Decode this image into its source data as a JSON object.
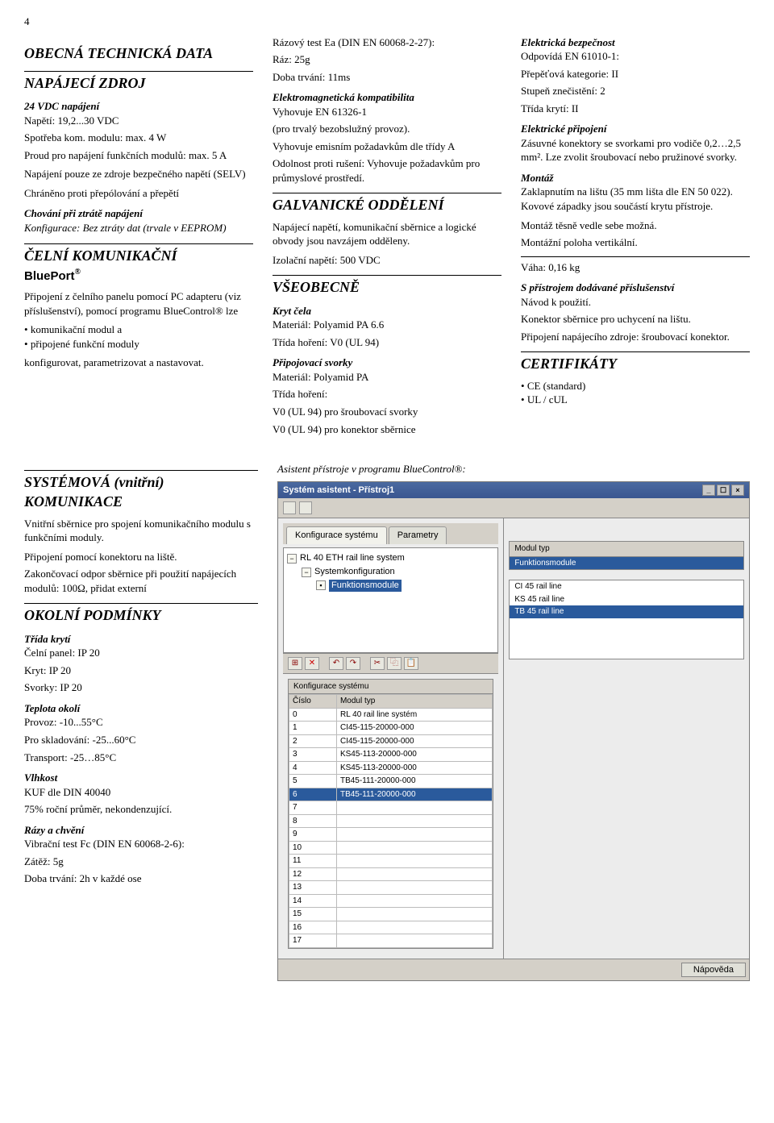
{
  "page_number": "4",
  "col1": {
    "h1": "OBECNÁ TECHNICKÁ DATA",
    "h2": "NAPÁJECÍ ZDROJ",
    "p1": "24 VDC napájení",
    "p2": "Napětí: 19,2...30 VDC",
    "p3": "Spotřeba kom. modulu: max. 4 W",
    "p4": "Proud pro napájení funkčních modulů: max. 5 A",
    "p5": "Napájení pouze ze zdroje bezpečného napětí (SELV)",
    "p6": "Chráněno proti přepólování a přepětí",
    "p7t": "Chování při ztrátě napájení",
    "p7": "Konfigurace: Bez ztráty dat (trvale v EEPROM)",
    "h3": "ČELNÍ KOMUNIKAČNÍ",
    "h3b": "BluePort",
    "h3s": "®",
    "p8": "Připojení z čelního panelu pomocí PC adapteru (viz příslušenství), pomocí programu BlueControl® lze",
    "b1": "komunikační modul a",
    "b2": "připojené funkční moduly",
    "p9": "konfigurovat, parametrizovat a nastavovat."
  },
  "col2": {
    "p1": "Rázový test Ea (DIN EN 60068-2-27):",
    "p2": "Ráz: 25g",
    "p3": "Doba trvání: 11ms",
    "p4t": "Elektromagnetická kompatibilita",
    "p4": "Vyhovuje EN 61326-1",
    "p5": "(pro trvalý bezobslužný provoz).",
    "p6": "Vyhovuje emisním požadavkům dle třídy A",
    "p7": "Odolnost proti rušení: Vyhovuje požadavkům pro průmyslové prostředí.",
    "h1": "GALVANICKÉ ODDĚLENÍ",
    "p8": "Napájecí napětí, komunikační sběrnice a logické obvody jsou navzájem odděleny.",
    "p9": "Izolační napětí:  500 VDC",
    "h2": "VŠEOBECNĚ",
    "p10t": "Kryt čela",
    "p10": "Materiál: Polyamid PA 6.6",
    "p11": "Třída hoření: V0 (UL 94)",
    "p12t": "Připojovací svorky",
    "p12": "Materiál: Polyamid PA",
    "p13": "Třída hoření:",
    "p14": "V0 (UL 94) pro šroubovací svorky",
    "p15": "V0 (UL 94) pro konektor sběrnice"
  },
  "col3": {
    "p1t": "Elektrická bezpečnost",
    "p1": "Odpovídá EN 61010-1:",
    "p2": "Přepěťová kategorie: II",
    "p3": "Stupeň znečistění: 2",
    "p4": "Třída krytí: II",
    "p5t": "Elektrické připojení",
    "p5": "Zásuvné konektory se svorkami pro vodiče 0,2…2,5 mm². Lze zvolit šroubovací nebo pružinové svorky.",
    "p6t": "Montáž",
    "p6": "Zaklapnutím na lištu (35 mm lišta dle EN 50 022). Kovové západky jsou součástí krytu přístroje.",
    "p7": "Montáž těsně vedle sebe možná.",
    "p8": "Montážní poloha vertikální.",
    "p9": "Váha: 0,16 kg",
    "p10t": "S přístrojem dodávané příslušenství",
    "p10": "Návod k použití.",
    "p11": "Konektor sběrnice pro uchycení na lištu.",
    "p12": "Připojení napájecího zdroje: šroubovací konektor.",
    "h1": "CERTIFIKÁTY",
    "b1": "CE (standard)",
    "b2": "UL / cUL"
  },
  "lower_left": {
    "h1": "SYSTÉMOVÁ (vnitřní) KOMUNIKACE",
    "p1": "Vnitřní sběrnice pro spojení komunikačního modulu s funkčními moduly.",
    "p2": "Připojení pomocí konektoru na liště.",
    "p3": "Zakončovací odpor sběrnice při použití napájecích modulů: 100Ω, přidat externí",
    "h2": "OKOLNÍ PODMÍNKY",
    "p4t": "Třída krytí",
    "p4": "Čelní panel: IP 20",
    "p5": "Kryt: IP 20",
    "p6": "Svorky: IP 20",
    "p7t": "Teplota okolí",
    "p7": "Provoz: -10...55°C",
    "p8": "Pro skladování: -25...60°C",
    "p9": "Transport: -25…85°C",
    "p10t": "Vlhkost",
    "p10": "KUF dle DIN 40040",
    "p11": "75% roční průměr, nekondenzující.",
    "p12t": "Rázy a chvění",
    "p12": "Vibrační test Fc (DIN EN 60068-2-6):",
    "p13": "Zátěž: 5g",
    "p14": "Doba trvání: 2h v každé ose"
  },
  "asist_label": "Asistent přístroje v programu BlueControl®:",
  "win": {
    "title": "Systém asistent - Přístroj1",
    "tab1": "Konfigurace systému",
    "tab2": "Parametry",
    "tree": {
      "n1": "RL 40 ETH rail line system",
      "n2": "Systemkonfiguration",
      "n3": "Funktionsmodule"
    },
    "right_hdr": "Modul typ",
    "right_hdr2": "Funktionsmodule",
    "right_items": [
      "CI 45 rail line",
      "KS 45 rail line",
      "TB 45 rail line"
    ],
    "grid_label": "Konfigurace systému",
    "grid_cols": [
      "Číslo",
      "Modul typ"
    ],
    "grid_rows": [
      [
        "0",
        "RL 40 rail line systém"
      ],
      [
        "1",
        "CI45-115-20000-000"
      ],
      [
        "2",
        "CI45-115-20000-000"
      ],
      [
        "3",
        "KS45-113-20000-000"
      ],
      [
        "4",
        "KS45-113-20000-000"
      ],
      [
        "5",
        "TB45-111-20000-000"
      ],
      [
        "6",
        "TB45-111-20000-000"
      ],
      [
        "7",
        ""
      ],
      [
        "8",
        ""
      ],
      [
        "9",
        ""
      ],
      [
        "10",
        ""
      ],
      [
        "11",
        ""
      ],
      [
        "12",
        ""
      ],
      [
        "13",
        ""
      ],
      [
        "14",
        ""
      ],
      [
        "15",
        ""
      ],
      [
        "16",
        ""
      ],
      [
        "17",
        ""
      ]
    ],
    "footer_btn": "Nápověda"
  }
}
